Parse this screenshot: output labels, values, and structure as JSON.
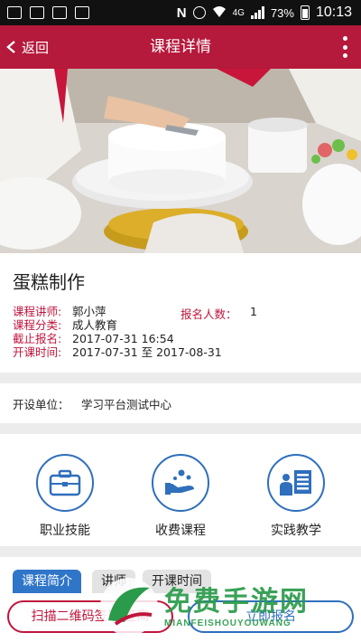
{
  "status_bar": {
    "battery": "73%",
    "time": "10:13",
    "network": "4G"
  },
  "header": {
    "back_label": "返回",
    "title": "课程详情"
  },
  "course": {
    "name": "蛋糕制作",
    "lecturer_label": "课程讲师:",
    "lecturer": "郭小萍",
    "category_label": "课程分类:",
    "category": "成人教育",
    "deadline_label": "截止报名:",
    "deadline": "2017-07-31 16:54",
    "period_label": "开课时间:",
    "period": "2017-07-31 至 2017-08-31",
    "enroll_label": "报名人数：",
    "enroll_count": "1"
  },
  "org": {
    "label": "开设单位：",
    "value": "学习平台测试中心"
  },
  "features": [
    {
      "label": "职业技能",
      "icon": "briefcase-icon"
    },
    {
      "label": "收费课程",
      "icon": "hand-coins-icon"
    },
    {
      "label": "实践教学",
      "icon": "person-board-icon"
    }
  ],
  "tabs": [
    "课程简介",
    "讲师",
    "开课时间"
  ],
  "buttons": {
    "scan": "扫描二维码签到/签离",
    "enroll": "立即报名"
  },
  "watermark": {
    "text": "免费手游网",
    "sub": "MIANFEISHOUYOUWANG"
  },
  "colors": {
    "primary": "#b5193b",
    "accent_blue": "#2f76c8",
    "label_red": "#c0143c"
  }
}
